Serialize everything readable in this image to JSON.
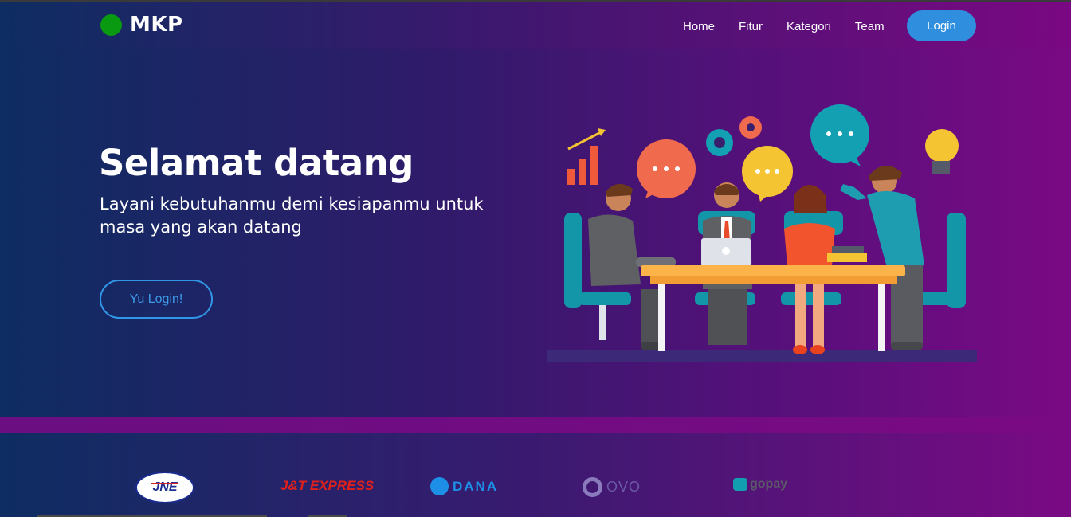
{
  "brand": {
    "name": "MKP",
    "dot_color": "#0a9a12"
  },
  "nav": {
    "items": [
      {
        "label": "Home"
      },
      {
        "label": "Fitur"
      },
      {
        "label": "Kategori"
      },
      {
        "label": "Team"
      }
    ],
    "login_label": "Login"
  },
  "hero": {
    "title": "Selamat datang",
    "subtitle": "Layani kebutuhanmu demi kesiapanmu untuk masa yang akan datang",
    "cta_label": "Yu Login!",
    "illustration": "team-meeting-illustration"
  },
  "partners": [
    {
      "name": "JNE",
      "icon": "jne-logo"
    },
    {
      "name": "J&T EXPRESS",
      "icon": "jnt-logo"
    },
    {
      "name": "DANA",
      "icon": "dana-logo"
    },
    {
      "name": "OVO",
      "icon": "ovo-logo"
    },
    {
      "name": "gopay",
      "icon": "gopay-logo"
    }
  ],
  "colors": {
    "accent": "#2f8fde",
    "gradient_start": "#0e2d62",
    "gradient_end": "#7a0a84"
  }
}
